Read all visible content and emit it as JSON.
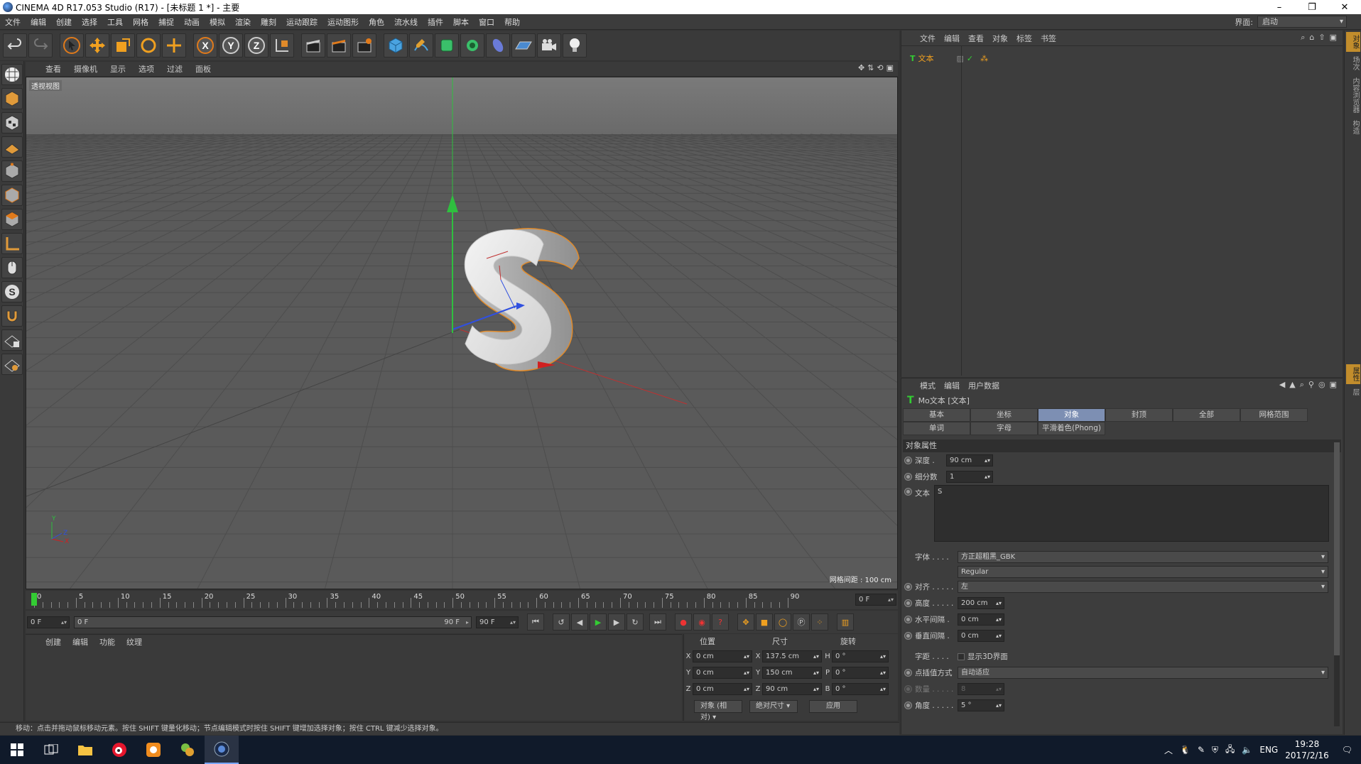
{
  "window": {
    "title": "CINEMA 4D R17.053 Studio (R17) - [未标题 1 *] - 主要",
    "min": "–",
    "max": "❐",
    "close": "✕"
  },
  "menubar": [
    "文件",
    "编辑",
    "创建",
    "选择",
    "工具",
    "网格",
    "捕捉",
    "动画",
    "模拟",
    "渲染",
    "雕刻",
    "运动跟踪",
    "运动图形",
    "角色",
    "流水线",
    "插件",
    "脚本",
    "窗口",
    "帮助"
  ],
  "layout": {
    "label": "界面:",
    "value": "启动"
  },
  "viewport": {
    "menu": [
      "查看",
      "摄像机",
      "显示",
      "选项",
      "过滤",
      "面板"
    ],
    "label": "透视视图",
    "grid_info": "网格间距 : 100 cm",
    "axis_x": "X",
    "axis_y": "Y",
    "axis_z": "Z",
    "text_object": "S"
  },
  "timeline": {
    "ticks": [
      "0",
      "5",
      "10",
      "15",
      "20",
      "25",
      "30",
      "35",
      "40",
      "45",
      "50",
      "55",
      "60",
      "65",
      "70",
      "75",
      "80",
      "85",
      "90"
    ],
    "current_frame": "0 F"
  },
  "playbar": {
    "start": "0 F",
    "range_start": "0 F",
    "range_end": "90 F",
    "end": "90 F"
  },
  "materials": {
    "menu": [
      "创建",
      "编辑",
      "功能",
      "纹理"
    ]
  },
  "coords": {
    "headers": [
      "位置",
      "尺寸",
      "旋转"
    ],
    "rows": [
      {
        "pos_axis": "X",
        "pos": "0 cm",
        "size_axis": "X",
        "size": "137.5 cm",
        "rot_axis": "H",
        "rot": "0 °"
      },
      {
        "pos_axis": "Y",
        "pos": "0 cm",
        "size_axis": "Y",
        "size": "150 cm",
        "rot_axis": "P",
        "rot": "0 °"
      },
      {
        "pos_axis": "Z",
        "pos": "0 cm",
        "size_axis": "Z",
        "size": "90 cm",
        "rot_axis": "B",
        "rot": "0 °"
      }
    ],
    "mode": "对象 (相对)",
    "size_mode": "绝对尺寸",
    "apply": "应用"
  },
  "status": "移动：点击并拖动鼠标移动元素。按住 SHIFT 键量化移动；节点编辑模式时按住 SHIFT 键增加选择对象；按住 CTRL 键减少选择对象。",
  "objects": {
    "menu": [
      "文件",
      "编辑",
      "查看",
      "对象",
      "标签",
      "书签"
    ],
    "items": [
      {
        "name": "文本"
      }
    ]
  },
  "attributes": {
    "menu": [
      "模式",
      "编辑",
      "用户数据"
    ],
    "title": "Mo文本 [文本]",
    "tabs": [
      "基本",
      "坐标",
      "对象",
      "封顶",
      "全部",
      "网格范围",
      "单词",
      "字母",
      "平滑着色(Phong)"
    ],
    "active_tab": "对象",
    "section": "对象属性",
    "depth_label": "深度 .",
    "depth": "90 cm",
    "subdiv_label": "细分数",
    "subdiv": "1",
    "text_label": "文本",
    "text_value": "S",
    "font_label": "字体 . . . .",
    "font": "方正超粗黑_GBK",
    "font_style": "Regular",
    "align_label": "对齐 . . . . .",
    "align": "左",
    "height_label": "高度 . . . . .",
    "height": "200 cm",
    "hspace_label": "水平间隔 .",
    "hspace": "0 cm",
    "vspace_label": "垂直间隔 .",
    "vspace": "0 cm",
    "kerning_label": "字距 . . . .",
    "show3d": "显示3D界面",
    "interp_label": "点插值方式",
    "interp": "自动适应",
    "count_label": "数量 . . . . .",
    "count": "8",
    "angle_label": "角度 . . . . .",
    "angle": "5 °"
  },
  "right_tabs": [
    "对象",
    "场次",
    "内容浏览器",
    "构造",
    "属性",
    "层"
  ],
  "taskbar": {
    "lang": "ENG",
    "time": "19:28",
    "date": "2017/2/16"
  }
}
